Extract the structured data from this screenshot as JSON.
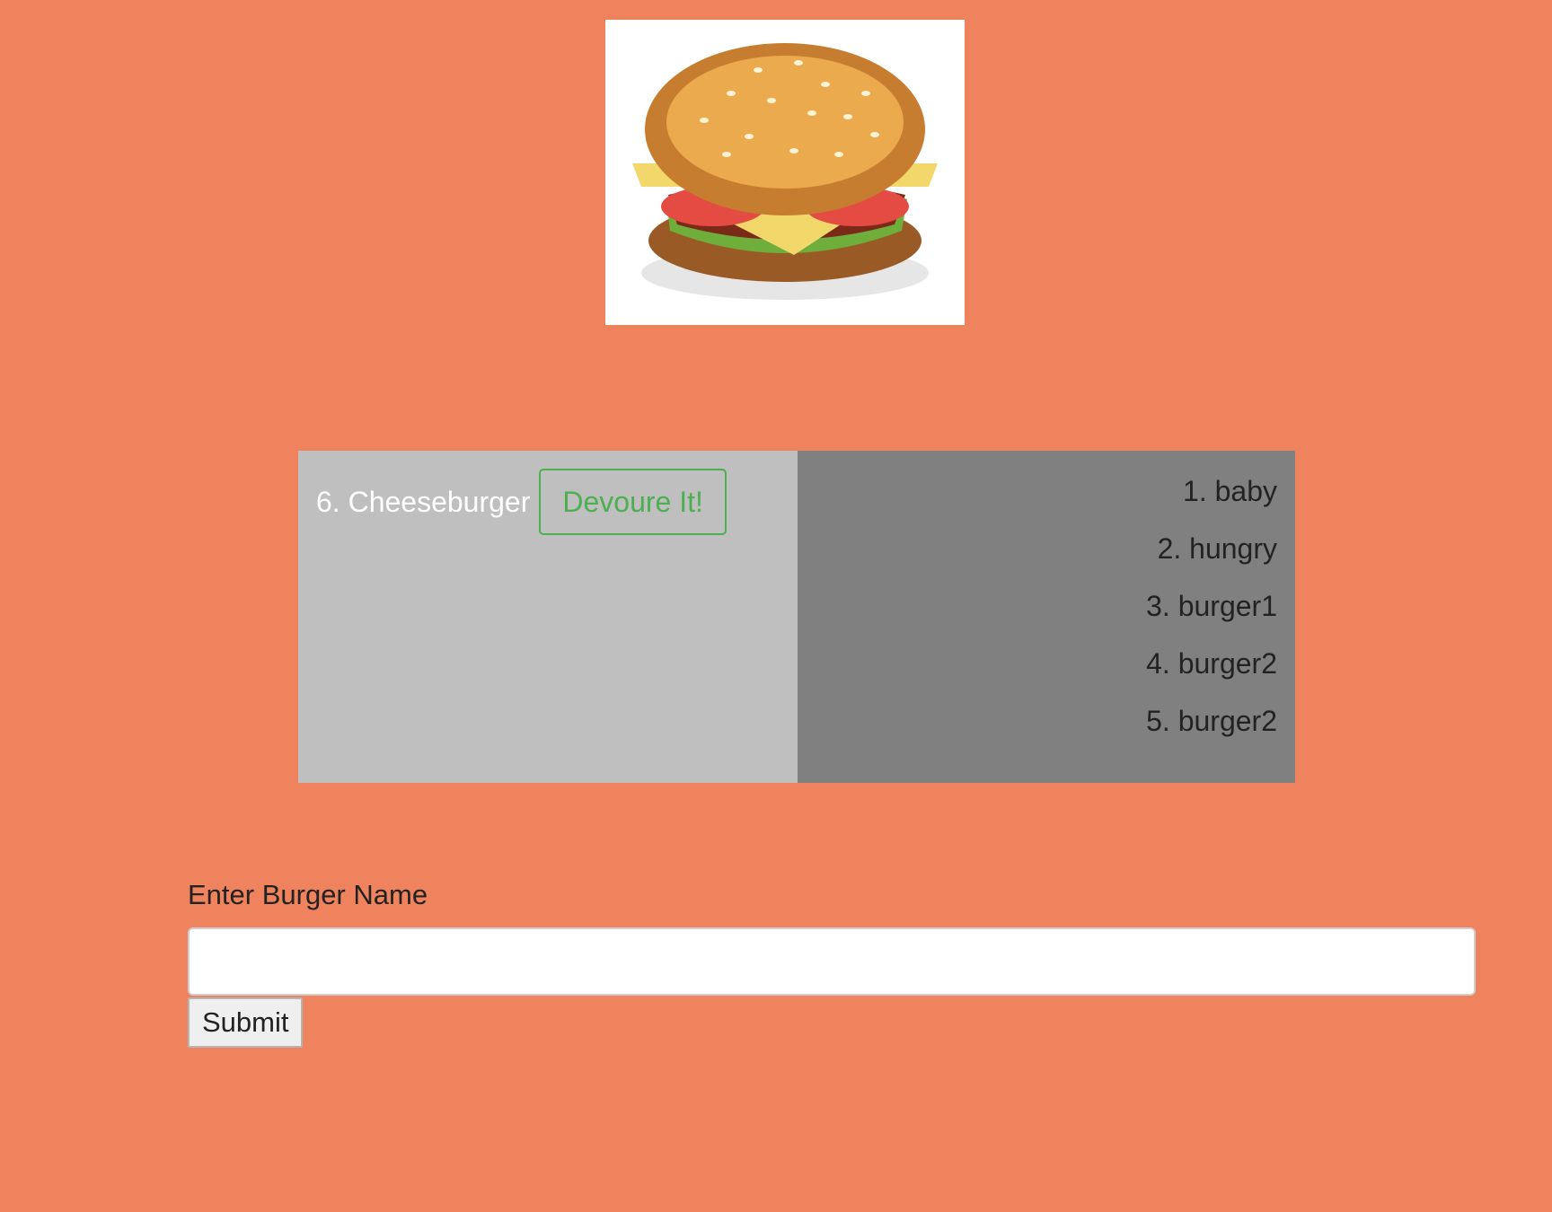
{
  "logo": {
    "icon": "burger-image",
    "alt": "burger"
  },
  "uneaten": {
    "items": [
      {
        "label": "6. Cheeseburger",
        "button_label": "Devoure It!"
      }
    ]
  },
  "devoured": {
    "items": [
      {
        "label": "1. baby"
      },
      {
        "label": "2. hungry"
      },
      {
        "label": "3. burger1"
      },
      {
        "label": "4. burger2"
      },
      {
        "label": "5. burger2"
      }
    ]
  },
  "form": {
    "label": "Enter Burger Name",
    "input_value": "",
    "input_placeholder": "",
    "submit_label": "Submit"
  },
  "colors": {
    "page_background": "#EF835D",
    "uneaten_panel": "#BFBFBF",
    "devoured_panel": "#808080",
    "devour_button": "#4CAF50"
  }
}
